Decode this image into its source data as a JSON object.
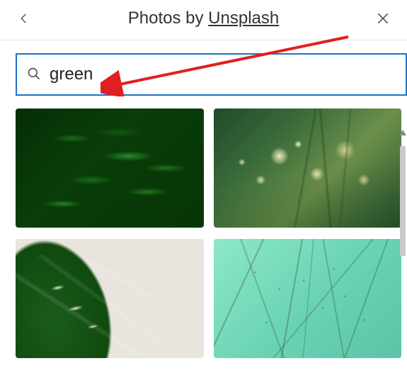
{
  "header": {
    "title_prefix": "Photos by ",
    "title_link": "Unsplash"
  },
  "search": {
    "value": "green",
    "placeholder": "Search"
  },
  "results": [
    {
      "alt": "dark green fern leaves"
    },
    {
      "alt": "green grass bokeh lights"
    },
    {
      "alt": "monstera leaf on cream background"
    },
    {
      "alt": "thin vines on mint green wall"
    }
  ],
  "annotation": {
    "type": "arrow",
    "color": "#e02020",
    "target": "search-input"
  }
}
